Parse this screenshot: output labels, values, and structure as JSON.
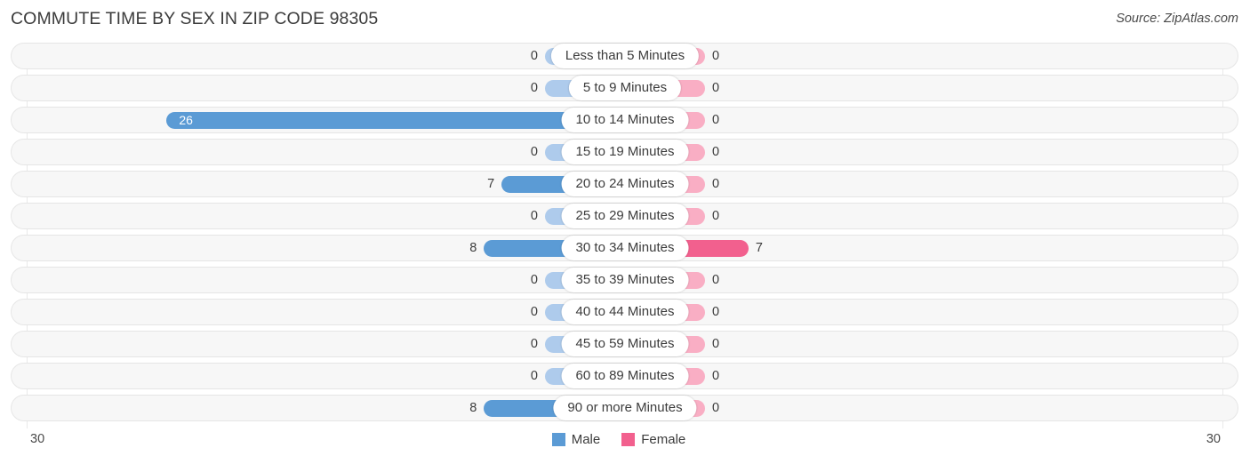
{
  "header": {
    "title": "COMMUTE TIME BY SEX IN ZIP CODE 98305",
    "source": "Source: ZipAtlas.com"
  },
  "axis": {
    "left_end": "30",
    "right_end": "30"
  },
  "legend": {
    "items": [
      {
        "label": "Male",
        "color": "#5b9bd5",
        "name": "legend-male"
      },
      {
        "label": "Female",
        "color": "#f2608e",
        "name": "legend-female"
      }
    ]
  },
  "chart_data": {
    "type": "bar",
    "title": "COMMUTE TIME BY SEX IN ZIP CODE 98305",
    "subtitle": "",
    "xlabel": "",
    "ylabel": "",
    "orientation": "horizontal-diverging",
    "grid": true,
    "legend_position": "bottom-center",
    "axis_max": 30,
    "xlim": [
      30,
      30
    ],
    "categories": [
      "Less than 5 Minutes",
      "5 to 9 Minutes",
      "10 to 14 Minutes",
      "15 to 19 Minutes",
      "20 to 24 Minutes",
      "25 to 29 Minutes",
      "30 to 34 Minutes",
      "35 to 39 Minutes",
      "40 to 44 Minutes",
      "45 to 59 Minutes",
      "60 to 89 Minutes",
      "90 or more Minutes"
    ],
    "series": [
      {
        "name": "Male",
        "color": "#5b9bd5",
        "direction": "left",
        "values": [
          0,
          0,
          26,
          0,
          7,
          0,
          8,
          0,
          0,
          0,
          0,
          8
        ]
      },
      {
        "name": "Female",
        "color": "#f2608e",
        "direction": "right",
        "values": [
          0,
          0,
          0,
          0,
          0,
          0,
          7,
          0,
          0,
          0,
          0,
          0
        ]
      }
    ]
  },
  "rows": [
    {
      "label": "Less than 5 Minutes",
      "male": "0",
      "female": "0"
    },
    {
      "label": "5 to 9 Minutes",
      "male": "0",
      "female": "0"
    },
    {
      "label": "10 to 14 Minutes",
      "male": "26",
      "female": "0"
    },
    {
      "label": "15 to 19 Minutes",
      "male": "0",
      "female": "0"
    },
    {
      "label": "20 to 24 Minutes",
      "male": "7",
      "female": "0"
    },
    {
      "label": "25 to 29 Minutes",
      "male": "0",
      "female": "0"
    },
    {
      "label": "30 to 34 Minutes",
      "male": "8",
      "female": "7"
    },
    {
      "label": "35 to 39 Minutes",
      "male": "0",
      "female": "0"
    },
    {
      "label": "40 to 44 Minutes",
      "male": "0",
      "female": "0"
    },
    {
      "label": "45 to 59 Minutes",
      "male": "0",
      "female": "0"
    },
    {
      "label": "60 to 89 Minutes",
      "male": "0",
      "female": "0"
    },
    {
      "label": "90 or more Minutes",
      "male": "8",
      "female": "0"
    }
  ]
}
